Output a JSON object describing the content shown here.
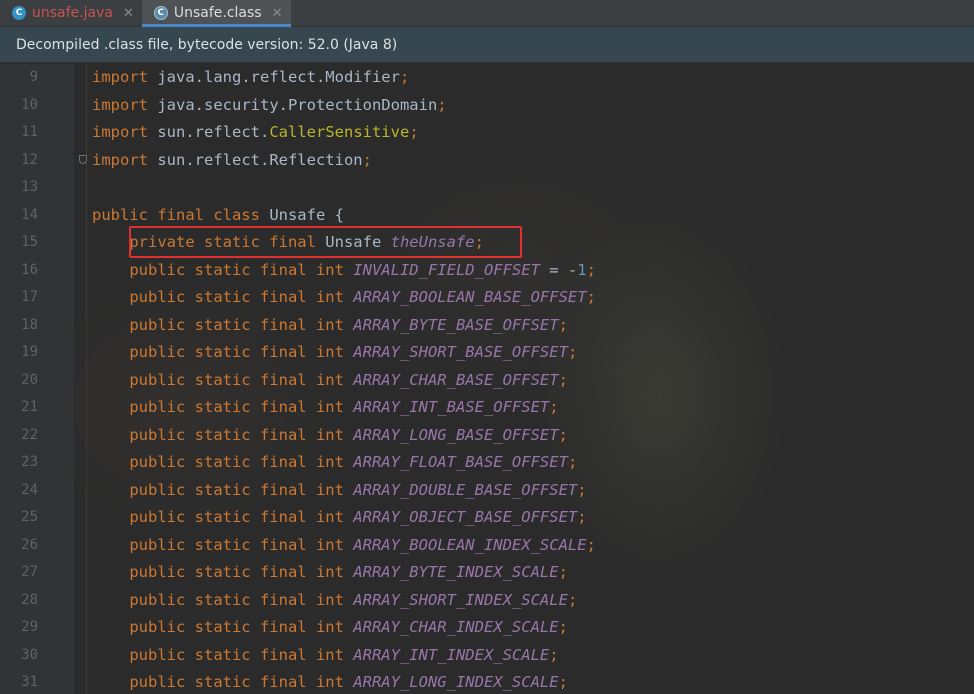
{
  "tabs": [
    {
      "label": "unsafe.java",
      "icon": "java-class-icon",
      "active": false
    },
    {
      "label": "Unsafe.class",
      "icon": "class-file-icon",
      "active": true
    }
  ],
  "banner": {
    "text": "Decompiled .class file, bytecode version: 52.0 (Java 8)"
  },
  "colors": {
    "keyword": "#cc7832",
    "field": "#9876aa",
    "annotation": "#bbb529",
    "number": "#6897bb",
    "text": "#a9b7c6",
    "highlight": "#e03030"
  },
  "code": {
    "lines": [
      {
        "num": "9",
        "parts": [
          [
            "kw",
            "import"
          ],
          [
            "t",
            " java.lang.reflect.Modifier"
          ],
          [
            "kw",
            ";"
          ]
        ]
      },
      {
        "num": "10",
        "parts": [
          [
            "kw",
            "import"
          ],
          [
            "t",
            " java.security.ProtectionDomain"
          ],
          [
            "kw",
            ";"
          ]
        ]
      },
      {
        "num": "11",
        "parts": [
          [
            "kw",
            "import"
          ],
          [
            "t",
            " sun.reflect."
          ],
          [
            "ann",
            "CallerSensitive"
          ],
          [
            "kw",
            ";"
          ]
        ]
      },
      {
        "num": "12",
        "parts": [
          [
            "kw",
            "import"
          ],
          [
            "t",
            " sun.reflect.Reflection"
          ],
          [
            "kw",
            ";"
          ]
        ],
        "fold": true
      },
      {
        "num": "13",
        "parts": []
      },
      {
        "num": "14",
        "parts": [
          [
            "kw",
            "public final class "
          ],
          [
            "t",
            "Unsafe {"
          ]
        ]
      },
      {
        "num": "15",
        "parts": [
          [
            "t",
            "    "
          ],
          [
            "kw",
            "private static final "
          ],
          [
            "t",
            "Unsafe "
          ],
          [
            "fld",
            "theUnsafe"
          ],
          [
            "kw",
            ";"
          ]
        ],
        "highlighted": true
      },
      {
        "num": "16",
        "parts": [
          [
            "t",
            "    "
          ],
          [
            "kw",
            "public static final int "
          ],
          [
            "fld",
            "INVALID_FIELD_OFFSET"
          ],
          [
            "t",
            " = -"
          ],
          [
            "num",
            "1"
          ],
          [
            "kw",
            ";"
          ]
        ]
      },
      {
        "num": "17",
        "parts": [
          [
            "t",
            "    "
          ],
          [
            "kw",
            "public static final int "
          ],
          [
            "fld",
            "ARRAY_BOOLEAN_BASE_OFFSET"
          ],
          [
            "kw",
            ";"
          ]
        ]
      },
      {
        "num": "18",
        "parts": [
          [
            "t",
            "    "
          ],
          [
            "kw",
            "public static final int "
          ],
          [
            "fld",
            "ARRAY_BYTE_BASE_OFFSET"
          ],
          [
            "kw",
            ";"
          ]
        ]
      },
      {
        "num": "19",
        "parts": [
          [
            "t",
            "    "
          ],
          [
            "kw",
            "public static final int "
          ],
          [
            "fld",
            "ARRAY_SHORT_BASE_OFFSET"
          ],
          [
            "kw",
            ";"
          ]
        ]
      },
      {
        "num": "20",
        "parts": [
          [
            "t",
            "    "
          ],
          [
            "kw",
            "public static final int "
          ],
          [
            "fld",
            "ARRAY_CHAR_BASE_OFFSET"
          ],
          [
            "kw",
            ";"
          ]
        ]
      },
      {
        "num": "21",
        "parts": [
          [
            "t",
            "    "
          ],
          [
            "kw",
            "public static final int "
          ],
          [
            "fld",
            "ARRAY_INT_BASE_OFFSET"
          ],
          [
            "kw",
            ";"
          ]
        ]
      },
      {
        "num": "22",
        "parts": [
          [
            "t",
            "    "
          ],
          [
            "kw",
            "public static final int "
          ],
          [
            "fld",
            "ARRAY_LONG_BASE_OFFSET"
          ],
          [
            "kw",
            ";"
          ]
        ]
      },
      {
        "num": "23",
        "parts": [
          [
            "t",
            "    "
          ],
          [
            "kw",
            "public static final int "
          ],
          [
            "fld",
            "ARRAY_FLOAT_BASE_OFFSET"
          ],
          [
            "kw",
            ";"
          ]
        ]
      },
      {
        "num": "24",
        "parts": [
          [
            "t",
            "    "
          ],
          [
            "kw",
            "public static final int "
          ],
          [
            "fld",
            "ARRAY_DOUBLE_BASE_OFFSET"
          ],
          [
            "kw",
            ";"
          ]
        ]
      },
      {
        "num": "25",
        "parts": [
          [
            "t",
            "    "
          ],
          [
            "kw",
            "public static final int "
          ],
          [
            "fld",
            "ARRAY_OBJECT_BASE_OFFSET"
          ],
          [
            "kw",
            ";"
          ]
        ]
      },
      {
        "num": "26",
        "parts": [
          [
            "t",
            "    "
          ],
          [
            "kw",
            "public static final int "
          ],
          [
            "fld",
            "ARRAY_BOOLEAN_INDEX_SCALE"
          ],
          [
            "kw",
            ";"
          ]
        ]
      },
      {
        "num": "27",
        "parts": [
          [
            "t",
            "    "
          ],
          [
            "kw",
            "public static final int "
          ],
          [
            "fld",
            "ARRAY_BYTE_INDEX_SCALE"
          ],
          [
            "kw",
            ";"
          ]
        ]
      },
      {
        "num": "28",
        "parts": [
          [
            "t",
            "    "
          ],
          [
            "kw",
            "public static final int "
          ],
          [
            "fld",
            "ARRAY_SHORT_INDEX_SCALE"
          ],
          [
            "kw",
            ";"
          ]
        ]
      },
      {
        "num": "29",
        "parts": [
          [
            "t",
            "    "
          ],
          [
            "kw",
            "public static final int "
          ],
          [
            "fld",
            "ARRAY_CHAR_INDEX_SCALE"
          ],
          [
            "kw",
            ";"
          ]
        ]
      },
      {
        "num": "30",
        "parts": [
          [
            "t",
            "    "
          ],
          [
            "kw",
            "public static final int "
          ],
          [
            "fld",
            "ARRAY_INT_INDEX_SCALE"
          ],
          [
            "kw",
            ";"
          ]
        ]
      },
      {
        "num": "31",
        "parts": [
          [
            "t",
            "    "
          ],
          [
            "kw",
            "public static final int "
          ],
          [
            "fld",
            "ARRAY_LONG_INDEX_SCALE"
          ],
          [
            "kw",
            ";"
          ]
        ]
      }
    ]
  }
}
